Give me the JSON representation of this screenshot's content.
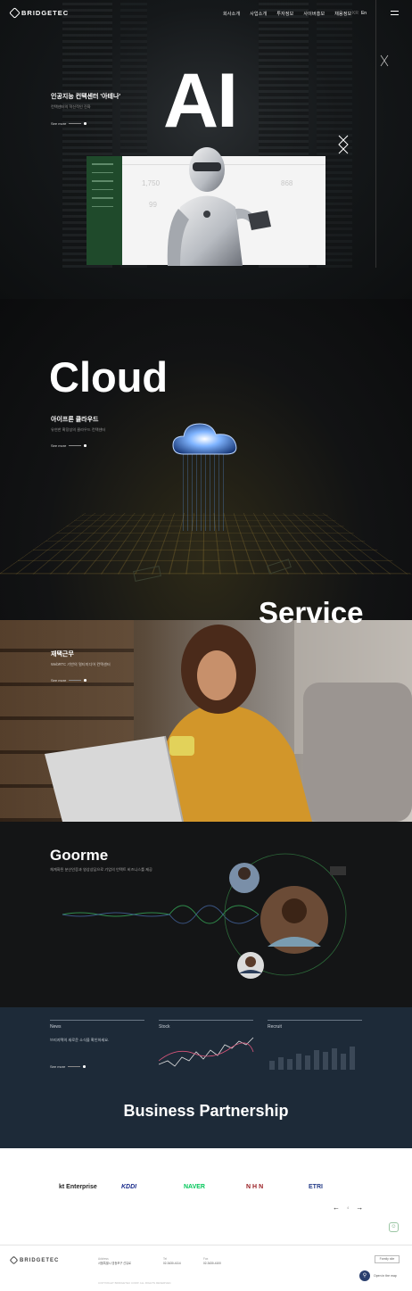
{
  "header": {
    "logo": "BRIDGETEC",
    "nav": [
      "회사소개",
      "사업소개",
      "투자정보",
      "사이버홍보",
      "채용정보"
    ],
    "lang_off": "KR",
    "lang_on": "En"
  },
  "ai": {
    "big": "AI",
    "title": "인공지능 컨택센터 '아테나'",
    "subtitle": "컨택센터의 혁신적인 진화",
    "see_more": "See more",
    "dash_nums": [
      "1,750",
      "99",
      "868"
    ]
  },
  "cloud": {
    "big": "Cloud",
    "title": "아이프론 클라우드",
    "subtitle": "유연한 확장성의 클라우드 컨택센터",
    "see_more": "See more"
  },
  "service": {
    "big": "Service",
    "title": "재택근무",
    "subtitle": "WebRTC 기반의 멀티미디어 컨택센터",
    "see_more": "See more"
  },
  "goorme": {
    "big": "Goorme",
    "subtitle": "체계화된 분산인증과 영상상담으로 기업의 언택트 비즈니스를 제공"
  },
  "info": {
    "news": "News",
    "stock": "Stock",
    "recruit": "Recruit",
    "news_text": "브리지텍의 새로운 소식을 확인하세요.",
    "see_more": "See more",
    "bp_title": "Business Partnership"
  },
  "partners": {
    "items": [
      "kt Enterprise",
      "KDDI",
      "NAVER",
      "NHN",
      "ETRI"
    ],
    "colors": [
      "#c8102e",
      "#1a2c8c",
      "#03c75a",
      "#9a1f24",
      "#233b87"
    ],
    "page": "4"
  },
  "footer": {
    "logo": "BRIDGETEC",
    "addr_label": "Address",
    "addr": "서울특별시 영등포구 선유로",
    "tel_label": "Tel",
    "tel": "02-3430-4114",
    "fax_label": "Fax",
    "fax": "02-3430-4100",
    "btn": "Family site",
    "map": "Open in the map",
    "copyright": "COPYRIGHT BRIDGETEC CORP. ALL RIGHTS RESERVED."
  }
}
